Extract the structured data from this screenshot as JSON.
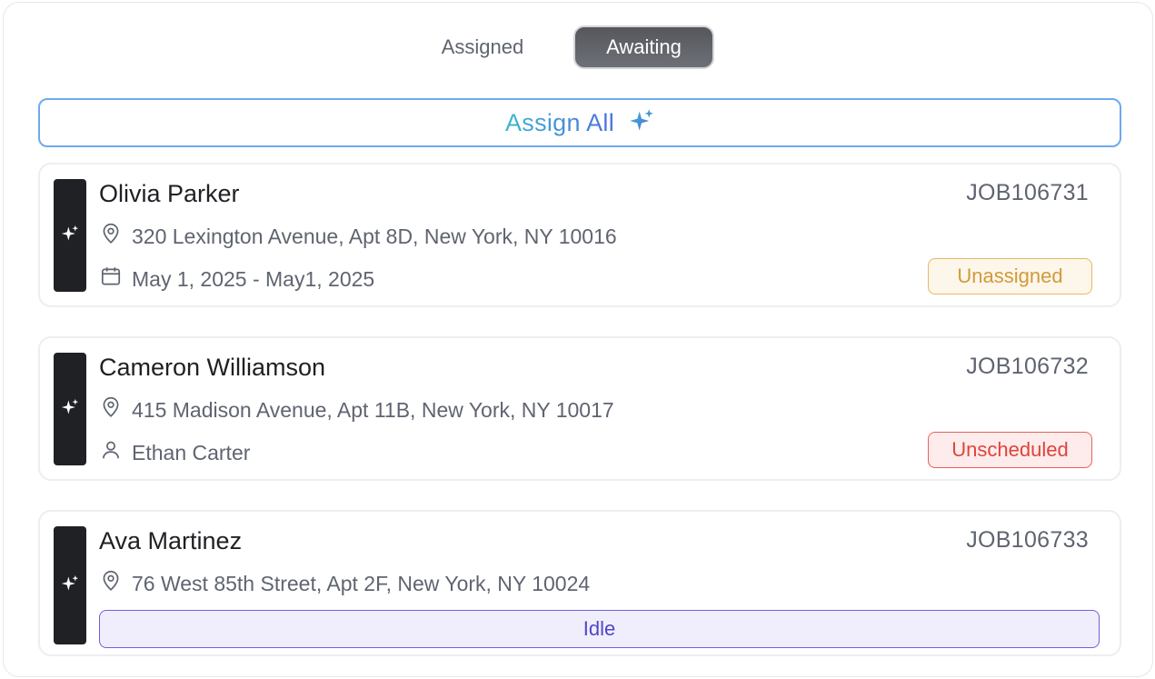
{
  "tabs": [
    {
      "label": "Assigned",
      "active": false
    },
    {
      "label": "Awaiting",
      "active": true
    }
  ],
  "assign_all": {
    "label": "Assign All",
    "icon": "sparkle-icon"
  },
  "jobs": [
    {
      "name": "Olivia Parker",
      "job_id": "JOB106731",
      "address": "320 Lexington Avenue, Apt 8D, New York, NY 10016",
      "detail_icon": "calendar-icon",
      "detail": "May 1, 2025 - May1, 2025",
      "status": "Unassigned"
    },
    {
      "name": "Cameron Williamson",
      "job_id": "JOB106732",
      "address": "415 Madison Avenue, Apt 11B, New York, NY 10017",
      "detail_icon": "person-icon",
      "detail": "Ethan Carter",
      "status": "Unscheduled"
    },
    {
      "name": "Ava Martinez",
      "job_id": "JOB106733",
      "address": "76 West 85th Street, Apt 2F, New York, NY 10024",
      "status": "Idle"
    }
  ],
  "colors": {
    "accent_border": "#6ea8ee",
    "assign_gradient_start": "#3fb7cf",
    "assign_gradient_end": "#4b6fe0",
    "unassigned": "#d19a3a",
    "unscheduled": "#e0433a",
    "idle": "#4f46c8",
    "ai_strip": "#1f2125"
  }
}
